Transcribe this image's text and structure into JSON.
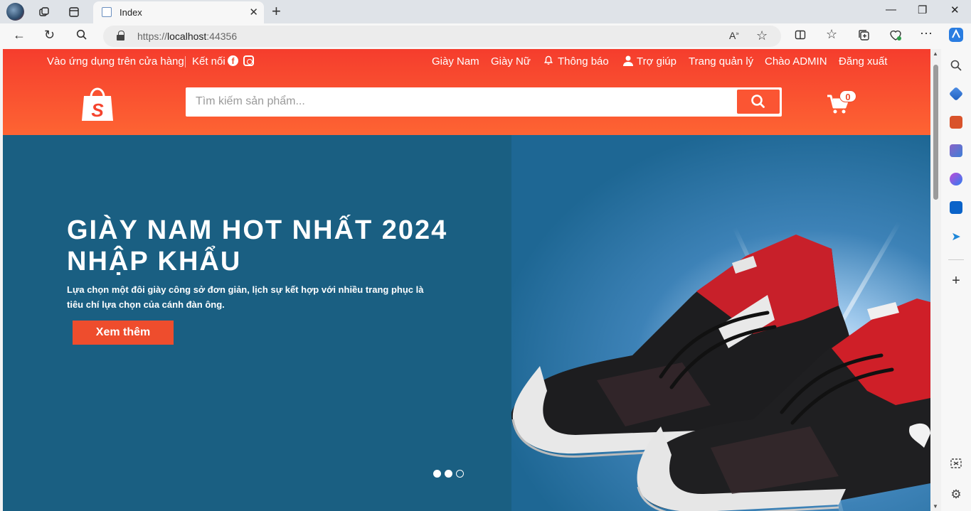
{
  "browser": {
    "tab_title": "Index",
    "url_prefix": "https://",
    "url_host": "localhost",
    "url_port": ":44356"
  },
  "topbar": {
    "app_link": "Vào ứng dụng trên cửa hàng",
    "connect": "Kết nối",
    "men_shoes": "Giày Nam",
    "women_shoes": "Giày Nữ",
    "notifications": "Thông báo",
    "help": "Trợ giúp",
    "admin_page": "Trang quản lý",
    "greeting": "Chào ADMIN",
    "logout": "Đăng xuất"
  },
  "search": {
    "placeholder": "Tìm kiếm sản phẩm..."
  },
  "cart": {
    "count": "0"
  },
  "hero": {
    "title_line1": "GIÀY NAM HOT NHẤT 2024",
    "title_line2": "NHẬP KHẨU",
    "description": "Lựa chọn một đôi giày công sở đơn giản, lịch sự kết hợp với nhiều trang phục là tiêu chí lựa chọn của cánh đàn ông.",
    "button": "Xem thêm",
    "slides": 3,
    "active_slide": 2
  },
  "colors": {
    "brand": "#ee4d2d",
    "hero_bg": "#1a5f82"
  }
}
